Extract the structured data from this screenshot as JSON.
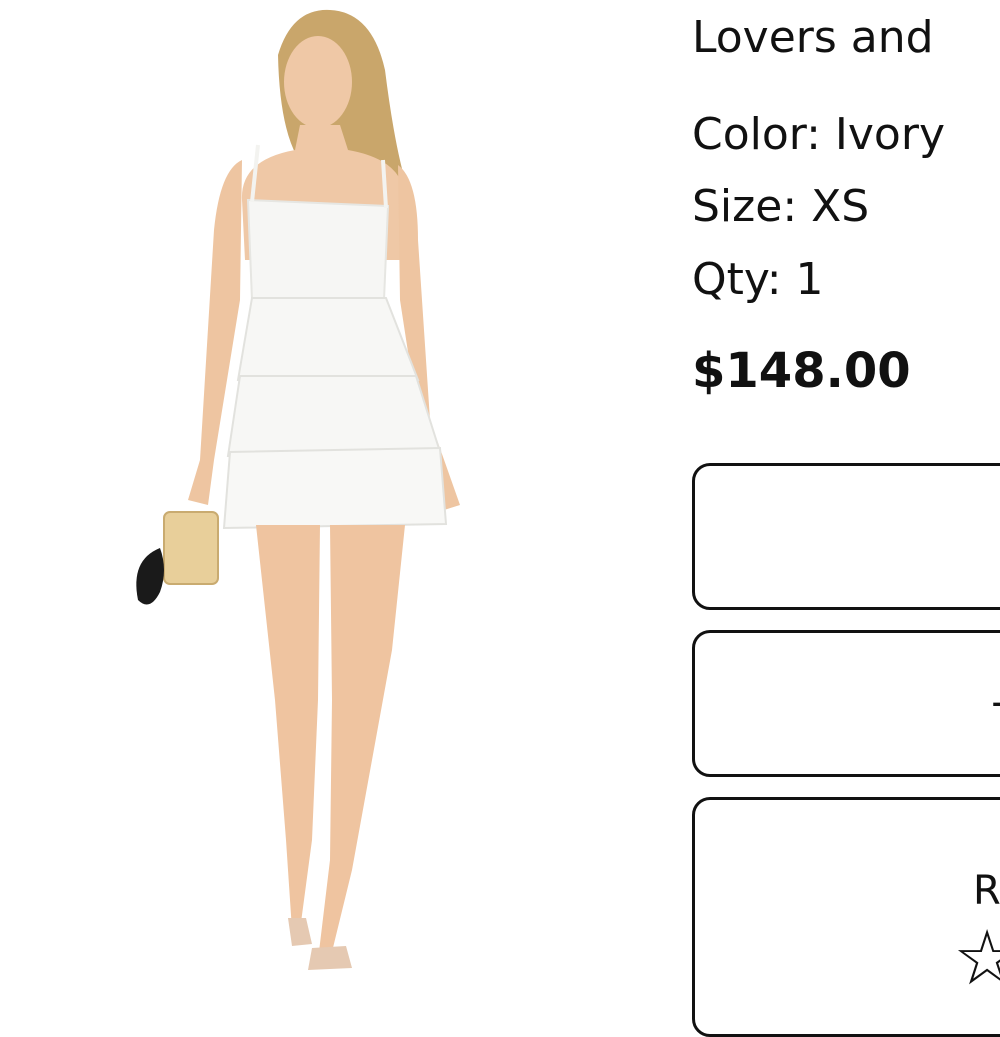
{
  "product": {
    "title": "Lovers and",
    "color": "Color: Ivory",
    "size": "Size: XS",
    "qty": "Qty: 1",
    "price": "$148.00"
  },
  "buttons": [
    {
      "label": ""
    },
    {
      "label": "+"
    },
    {
      "label": "R",
      "icon": "star-outline-icon"
    }
  ],
  "icons": {
    "star": "☆"
  },
  "colors": {
    "text": "#111111",
    "background": "#ffffff",
    "dress": "#f7f7f5",
    "bag": "#e8cf9a"
  }
}
